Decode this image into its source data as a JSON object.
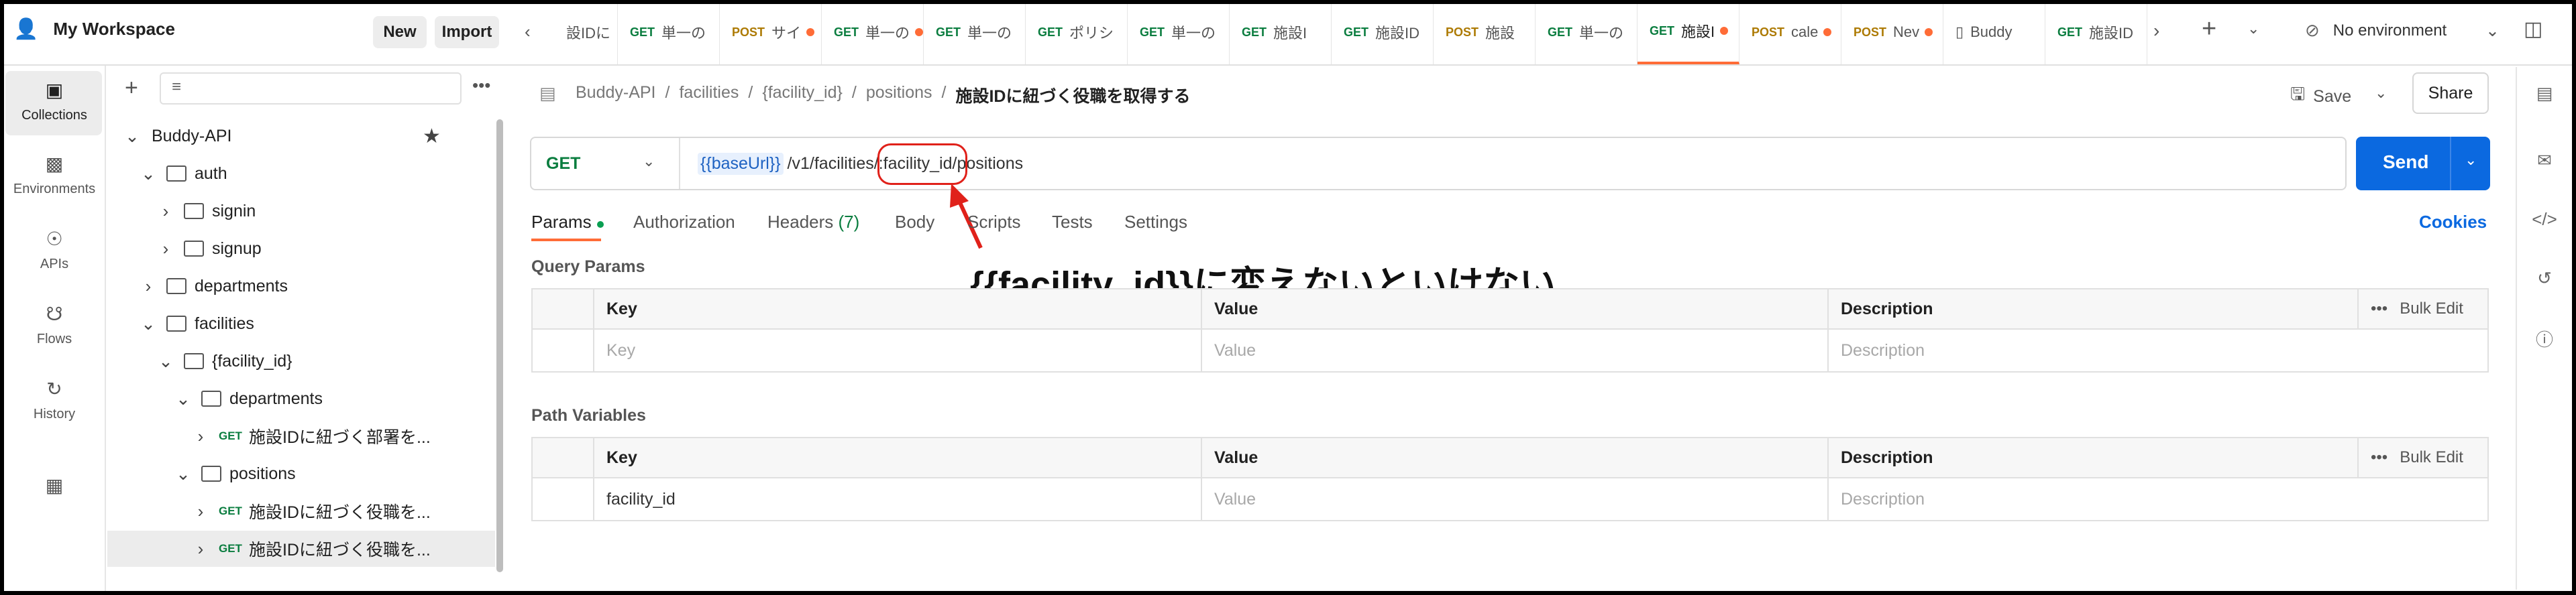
{
  "workspace": {
    "name": "My Workspace",
    "new_label": "New",
    "import_label": "Import"
  },
  "tabs": [
    {
      "method": "",
      "label": "設IDに",
      "dot": false
    },
    {
      "method": "GET",
      "label": "単一の",
      "dot": false
    },
    {
      "method": "POST",
      "label": "サイ",
      "dot": true
    },
    {
      "method": "GET",
      "label": "単一の",
      "dot": true
    },
    {
      "method": "GET",
      "label": "単一の",
      "dot": false
    },
    {
      "method": "GET",
      "label": "ポリシ",
      "dot": false
    },
    {
      "method": "GET",
      "label": "単一の",
      "dot": false
    },
    {
      "method": "GET",
      "label": "施設I",
      "dot": false
    },
    {
      "method": "GET",
      "label": "施設ID",
      "dot": false
    },
    {
      "method": "POST",
      "label": "施設",
      "dot": false
    },
    {
      "method": "GET",
      "label": "単一の",
      "dot": false
    },
    {
      "method": "GET",
      "label": "施設I",
      "dot": true
    },
    {
      "method": "POST",
      "label": "cale",
      "dot": true
    },
    {
      "method": "POST",
      "label": "Nev",
      "dot": true
    },
    {
      "method": "",
      "label": "Buddy",
      "dot": false
    },
    {
      "method": "GET",
      "label": "施設ID",
      "dot": false
    }
  ],
  "env_label": "No environment",
  "rail": [
    "Collections",
    "Environments",
    "APIs",
    "Flows",
    "History"
  ],
  "tree": {
    "root": "Buddy-API",
    "items": [
      "auth",
      "signin",
      "signup",
      "departments",
      "facilities",
      "{facility_id}",
      "departments",
      "施設IDに紐づく部署を...",
      "positions",
      "施設IDに紐づく役職を...",
      "施設IDに紐づく役職を..."
    ],
    "get_label": "GET"
  },
  "breadcrumb": {
    "parts": [
      "Buddy-API",
      "facilities",
      "{facility_id}",
      "positions"
    ],
    "current": "施設IDに紐づく役職を取得する",
    "sep": "/"
  },
  "header": {
    "save_label": "Save",
    "share_label": "Share"
  },
  "request": {
    "method": "GET",
    "base": "{{baseUrl}}",
    "path1": "/v1/facilities/",
    "path2": ":facility_id/",
    "path3": "positions",
    "send_label": "Send"
  },
  "subtabs": {
    "params": "Params",
    "authorization": "Authorization",
    "headers": "Headers",
    "headers_count": "(7)",
    "body": "Body",
    "scripts": "Scripts",
    "tests": "Tests",
    "settings": "Settings",
    "cookies": "Cookies"
  },
  "query": {
    "title": "Query Params",
    "cols": [
      "Key",
      "Value",
      "Description"
    ],
    "bulk": "Bulk Edit",
    "placeholders": [
      "Key",
      "Value",
      "Description"
    ]
  },
  "path_vars": {
    "title": "Path Variables",
    "cols": [
      "Key",
      "Value",
      "Description"
    ],
    "bulk": "Bulk Edit",
    "row_key": "facility_id",
    "placeholders": [
      "Value",
      "Description"
    ]
  },
  "annotation": "{{facility_id}}に変えないといけない",
  "colors": {
    "accent": "#0b69e0",
    "annotation": "#e0211a",
    "get": "#0a7d3f",
    "post": "#ad7a03",
    "tab_active": "#ff6c37"
  }
}
